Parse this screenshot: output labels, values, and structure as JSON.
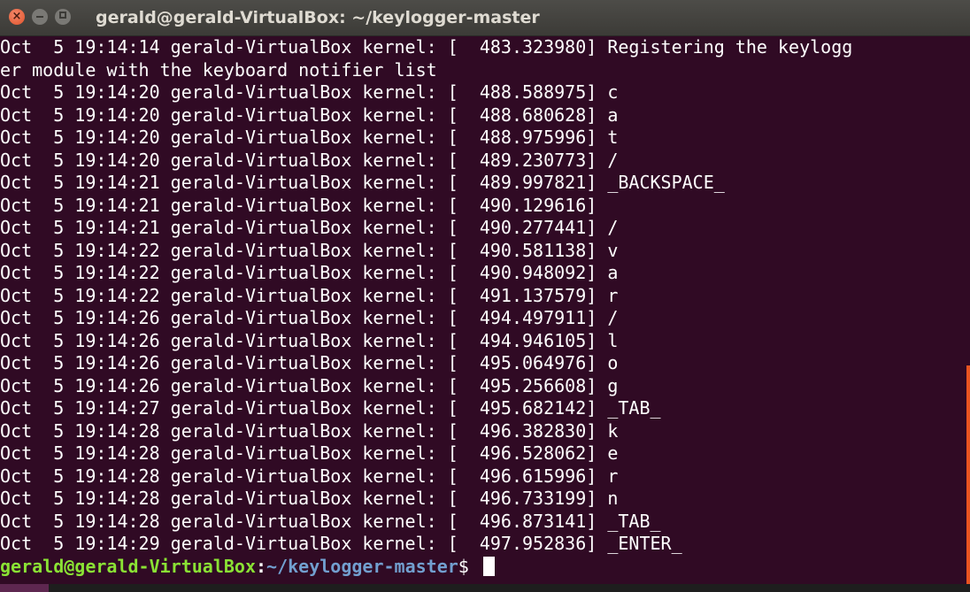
{
  "window": {
    "title": "gerald@gerald-VirtualBox: ~/keylogger-master",
    "close_glyph": "×"
  },
  "terminal": {
    "lines": [
      "Oct  5 19:14:14 gerald-VirtualBox kernel: [  483.323980] Registering the keylogg",
      "er module with the keyboard notifier list",
      "Oct  5 19:14:20 gerald-VirtualBox kernel: [  488.588975] c",
      "Oct  5 19:14:20 gerald-VirtualBox kernel: [  488.680628] a",
      "Oct  5 19:14:20 gerald-VirtualBox kernel: [  488.975996] t",
      "Oct  5 19:14:20 gerald-VirtualBox kernel: [  489.230773] /",
      "Oct  5 19:14:21 gerald-VirtualBox kernel: [  489.997821] _BACKSPACE_",
      "Oct  5 19:14:21 gerald-VirtualBox kernel: [  490.129616]",
      "Oct  5 19:14:21 gerald-VirtualBox kernel: [  490.277441] /",
      "Oct  5 19:14:22 gerald-VirtualBox kernel: [  490.581138] v",
      "Oct  5 19:14:22 gerald-VirtualBox kernel: [  490.948092] a",
      "Oct  5 19:14:22 gerald-VirtualBox kernel: [  491.137579] r",
      "Oct  5 19:14:26 gerald-VirtualBox kernel: [  494.497911] /",
      "Oct  5 19:14:26 gerald-VirtualBox kernel: [  494.946105] l",
      "Oct  5 19:14:26 gerald-VirtualBox kernel: [  495.064976] o",
      "Oct  5 19:14:26 gerald-VirtualBox kernel: [  495.256608] g",
      "Oct  5 19:14:27 gerald-VirtualBox kernel: [  495.682142] _TAB_",
      "Oct  5 19:14:28 gerald-VirtualBox kernel: [  496.382830] k",
      "Oct  5 19:14:28 gerald-VirtualBox kernel: [  496.528062] e",
      "Oct  5 19:14:28 gerald-VirtualBox kernel: [  496.615996] r",
      "Oct  5 19:14:28 gerald-VirtualBox kernel: [  496.733199] n",
      "Oct  5 19:14:28 gerald-VirtualBox kernel: [  496.873141] _TAB_",
      "Oct  5 19:14:29 gerald-VirtualBox kernel: [  497.952836] _ENTER_"
    ],
    "prompt": {
      "user_host": "gerald@gerald-VirtualBox",
      "colon": ":",
      "path": "~/keylogger-master",
      "symbol": "$ "
    }
  },
  "colors": {
    "background": "#300a24",
    "prompt_user": "#8ae234",
    "prompt_path": "#729fcf",
    "scroll_thumb": "#e95420",
    "close_button": "#e0532b"
  },
  "icons": {
    "close": "close-icon",
    "minimize": "minimize-icon",
    "maximize": "maximize-icon"
  }
}
